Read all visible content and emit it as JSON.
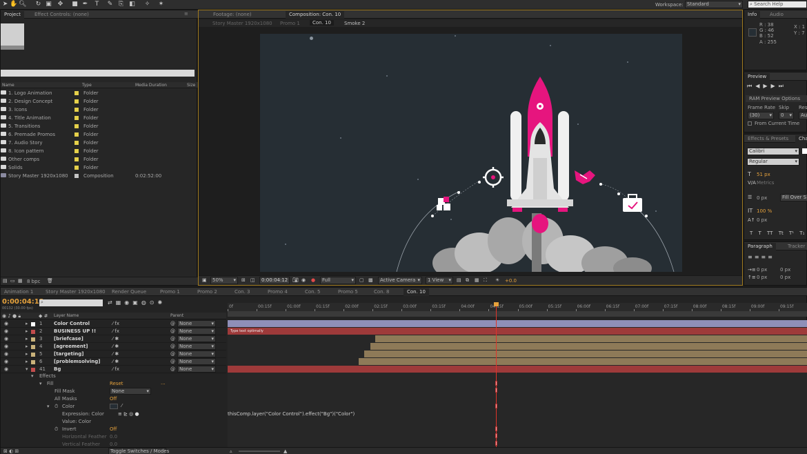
{
  "toolbar": {
    "workspace_label": "Workspace:",
    "workspace_value": "Standard",
    "search_placeholder": "Search Help"
  },
  "project_panel": {
    "tab_project": "Project",
    "tab_effect_controls": "Effect Controls: (none)",
    "columns": [
      "Name",
      "Type",
      "Media Duration",
      "Size"
    ],
    "items": [
      {
        "name": "1. Logo Animation",
        "type": "Folder",
        "duration": ""
      },
      {
        "name": "2. Design Concept",
        "type": "Folder",
        "duration": ""
      },
      {
        "name": "3. Icons",
        "type": "Folder",
        "duration": ""
      },
      {
        "name": "4. Title Animation",
        "type": "Folder",
        "duration": ""
      },
      {
        "name": "5. Transitions",
        "type": "Folder",
        "duration": ""
      },
      {
        "name": "6. Premade Promos",
        "type": "Folder",
        "duration": ""
      },
      {
        "name": "7. Audio Story",
        "type": "Folder",
        "duration": ""
      },
      {
        "name": "8. Icon pattern",
        "type": "Folder",
        "duration": ""
      },
      {
        "name": "Other comps",
        "type": "Folder",
        "duration": ""
      },
      {
        "name": "Solids",
        "type": "Folder",
        "duration": ""
      },
      {
        "name": "Story Master 1920x1080",
        "type": "Composition",
        "duration": "0:02:52:00"
      }
    ],
    "bpc": "8 bpc"
  },
  "composition_panel": {
    "tab_footage": "Footage: (none)",
    "tab_composition": "Composition: Con. 10",
    "breadcrumbs": [
      "Story Master 1920x1080",
      "Promo 1",
      "Con. 10",
      "Smoke 2"
    ],
    "zoom": "50%",
    "timecode": "0:00:04:12",
    "resolution": "Full",
    "camera": "Active Camera",
    "view": "1 View",
    "exposure": "+0.0"
  },
  "info_panel": {
    "tab_info": "Info",
    "tab_audio": "Audio",
    "r": "R : 38",
    "g": "G : 46",
    "b": "B : 52",
    "a": "A : 255",
    "x": "X : 1",
    "y": "Y : 7"
  },
  "preview_panel": {
    "tab": "Preview",
    "ram_options": "RAM Preview Options",
    "frame_rate_label": "Frame Rate",
    "skip_label": "Skip",
    "resolution_label": "Res",
    "frame_rate_value": "(30)",
    "skip_value": "0",
    "resolution_value": "Au",
    "from_current": "From Current Time"
  },
  "effects_panel": {
    "tab_effects": "Effects & Presets",
    "tab_character": "Cha",
    "font": "Calibri",
    "style": "Regular",
    "size": "51 px",
    "tracking_metrics": "Metrics",
    "leading": "0 px",
    "fill_over": "Fill Over S",
    "scale": "100 %",
    "baseline": "0 px",
    "type_buttons": [
      "T",
      "T",
      "TT",
      "Tt",
      "T¹",
      "T₁"
    ]
  },
  "paragraph_panel": {
    "tab_paragraph": "Paragraph",
    "tab_tracker": "Tracker",
    "indent_values": [
      "0 px",
      "0 px",
      "0 px",
      "0 px"
    ]
  },
  "timeline": {
    "tabs": [
      "Animation 1",
      "Story Master 1920x1080",
      "Render Queue",
      "Promo 1",
      "Promo 2",
      "Con. 3",
      "Promo 4",
      "Con. 5",
      "Promo 5",
      "Con. 8",
      "Con. 10"
    ],
    "timecode": "0:00:04:12",
    "fps": "00132 (30.00 fps)",
    "column_layer_name": "Layer Name",
    "column_parent": "Parent",
    "ruler": [
      "0f",
      "00:15f",
      "01:00f",
      "01:15f",
      "02:00f",
      "02:15f",
      "03:00f",
      "03:15f",
      "04:00f",
      "04:15f",
      "05:00f",
      "05:15f",
      "06:00f",
      "06:15f",
      "07:00f",
      "07:15f",
      "08:00f",
      "08:15f",
      "09:00f",
      "09:15f"
    ],
    "playhead_fraction": 0.463,
    "layers": [
      {
        "num": "1",
        "name": "Color Control",
        "parent": "None",
        "label_color": "#ffffff",
        "bar_color": "#8f8fb8",
        "bar_start": 0.0
      },
      {
        "num": "2",
        "name": "BUSINESS UP !!",
        "parent": "None",
        "label_color": "#c14c4c",
        "bar_color": "#9e3a3a",
        "bar_start": 0.0
      },
      {
        "num": "3",
        "name": "[briefcase]",
        "parent": "None",
        "label_color": "#c9b27a",
        "bar_color": "#8e7a58",
        "bar_start": 0.254
      },
      {
        "num": "4",
        "name": "[agreement]",
        "parent": "None",
        "label_color": "#c9b27a",
        "bar_color": "#8e7a58",
        "bar_start": 0.246
      },
      {
        "num": "5",
        "name": "[targeting]",
        "parent": "None",
        "label_color": "#c9b27a",
        "bar_color": "#8e7a58",
        "bar_start": 0.236
      },
      {
        "num": "6",
        "name": "[problemsolving]",
        "parent": "None",
        "label_color": "#c9b27a",
        "bar_color": "#8e7a58",
        "bar_start": 0.226
      },
      {
        "num": "41",
        "name": "Bg",
        "parent": "None",
        "label_color": "#c14c4c",
        "bar_color": "#9e3a3a",
        "bar_start": 0.0
      }
    ],
    "text_bar_label": "Type text optimally",
    "effects_label": "Effects",
    "fill_label": "Fill",
    "reset_label": "Reset",
    "fill_mask_label": "Fill Mask",
    "fill_mask_value": "None",
    "all_masks_label": "All Masks",
    "all_masks_value": "Off",
    "color_label": "Color",
    "expression_label": "Expression: Color",
    "value_label": "Value: Color",
    "invert_label": "Invert",
    "invert_value": "Off",
    "h_feather_label": "Horizontal Feather",
    "h_feather_value": "0.0",
    "v_feather_label": "Vertical Feather",
    "v_feather_value": "0.0",
    "expression_text": "thisComp.layer(\"Color Control\").effect(\"Bg\")(\"Color\")",
    "toggle_label": "Toggle Switches / Modes"
  },
  "colors": {
    "canvas_bg": "#262e34",
    "magenta": "#e6157e",
    "playhead": "#e0342a",
    "accent_orange": "#e6a23c"
  }
}
